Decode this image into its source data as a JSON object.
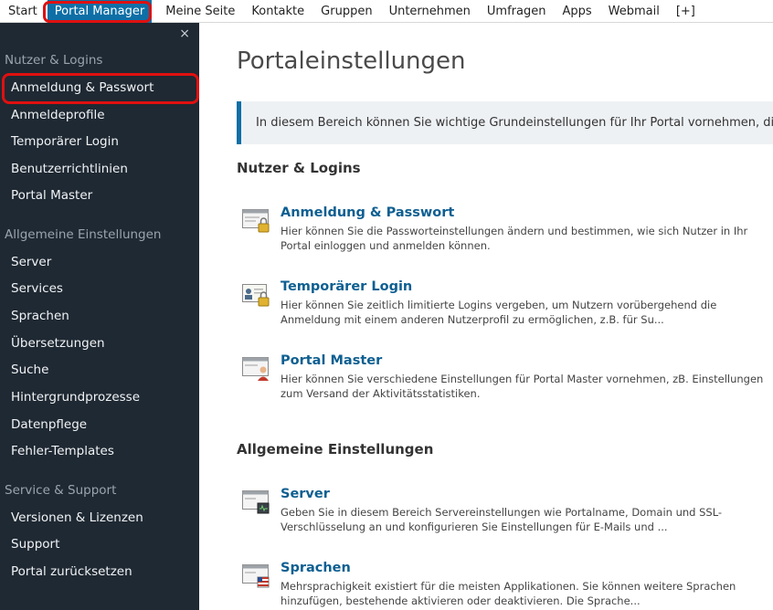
{
  "topnav": {
    "items": [
      "Start",
      "Portal Manager",
      "Meine Seite",
      "Kontakte",
      "Gruppen",
      "Unternehmen",
      "Umfragen",
      "Apps",
      "Webmail",
      "[+]"
    ],
    "active_index": 1
  },
  "sidebar": {
    "close_symbol": "×",
    "sections": [
      {
        "title": "Nutzer & Logins",
        "items": [
          "Anmeldung & Passwort",
          "Anmeldeprofile",
          "Temporärer Login",
          "Benutzerrichtlinien",
          "Portal Master"
        ]
      },
      {
        "title": "Allgemeine Einstellungen",
        "items": [
          "Server",
          "Services",
          "Sprachen",
          "Übersetzungen",
          "Suche",
          "Hintergrundprozesse",
          "Datenpflege",
          "Fehler-Templates"
        ]
      },
      {
        "title": "Service & Support",
        "items": [
          "Versionen & Lizenzen",
          "Support",
          "Portal zurücksetzen"
        ]
      }
    ],
    "highlighted_item": "Anmeldung & Passwort"
  },
  "main": {
    "title": "Portaleinstellungen",
    "info": "In diesem Bereich können Sie wichtige Grundeinstellungen für Ihr Portal vornehmen, die je",
    "sections": [
      {
        "heading": "Nutzer & Logins",
        "cards": [
          {
            "title": "Anmeldung & Passwort",
            "icon": "lock-window-icon",
            "desc": "Hier können Sie die Passworteinstellungen ändern und bestimmen, wie sich Nutzer in Ihr Portal einloggen und anmelden können."
          },
          {
            "title": "Temporärer Login",
            "icon": "id-card-lock-icon",
            "desc": "Hier können Sie zeitlich limitierte Logins vergeben, um Nutzern vorübergehend die Anmeldung mit einem anderen Nutzerprofil zu ermöglichen, z.B. für Su..."
          },
          {
            "title": "Portal Master",
            "icon": "admin-window-icon",
            "desc": "Hier können Sie verschiedene Einstellungen für Portal Master vornehmen, zB. Einstellungen zum Versand der Aktivitätsstatistiken."
          }
        ]
      },
      {
        "heading": "Allgemeine Einstellungen",
        "cards": [
          {
            "title": "Server",
            "icon": "server-window-icon",
            "desc": "Geben Sie in diesem Bereich Servereinstellungen wie Portalname, Domain und SSL-Verschlüsselung an und konfigurieren Sie Einstellungen für E-Mails und ..."
          },
          {
            "title": "Sprachen",
            "icon": "flag-window-icon",
            "desc": "Mehrsprachigkeit existiert für die meisten Applikationen. Sie können weitere Sprachen hinzufügen, bestehende aktivieren oder deaktivieren. Die Sprache..."
          }
        ]
      }
    ]
  },
  "colors": {
    "accent": "#0e6fa6",
    "sidebar_bg": "#1f2933",
    "highlight": "#e01010"
  }
}
